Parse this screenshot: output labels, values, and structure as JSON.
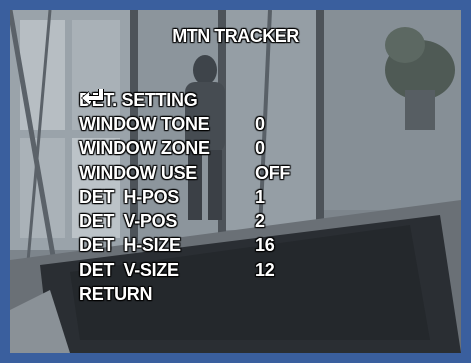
{
  "osd": {
    "title": "MTN TRACKER",
    "menu": [
      {
        "label": "DET. SETTING",
        "value": "",
        "icon": "enter-arrow-icon"
      },
      {
        "label": "WINDOW TONE",
        "value": "0"
      },
      {
        "label": "WINDOW ZONE",
        "value": "0"
      },
      {
        "label": "WINDOW USE",
        "value": "OFF"
      },
      {
        "label": "DET  H-POS",
        "value": "1"
      },
      {
        "label": "DET  V-POS",
        "value": "2"
      },
      {
        "label": "DET  H-SIZE",
        "value": "16"
      },
      {
        "label": "DET  V-SIZE",
        "value": "12"
      },
      {
        "label": "RETURN",
        "value": ""
      }
    ]
  },
  "colors": {
    "frame": "#3a5f9e",
    "text": "#ffffff",
    "outline": "#000000"
  }
}
